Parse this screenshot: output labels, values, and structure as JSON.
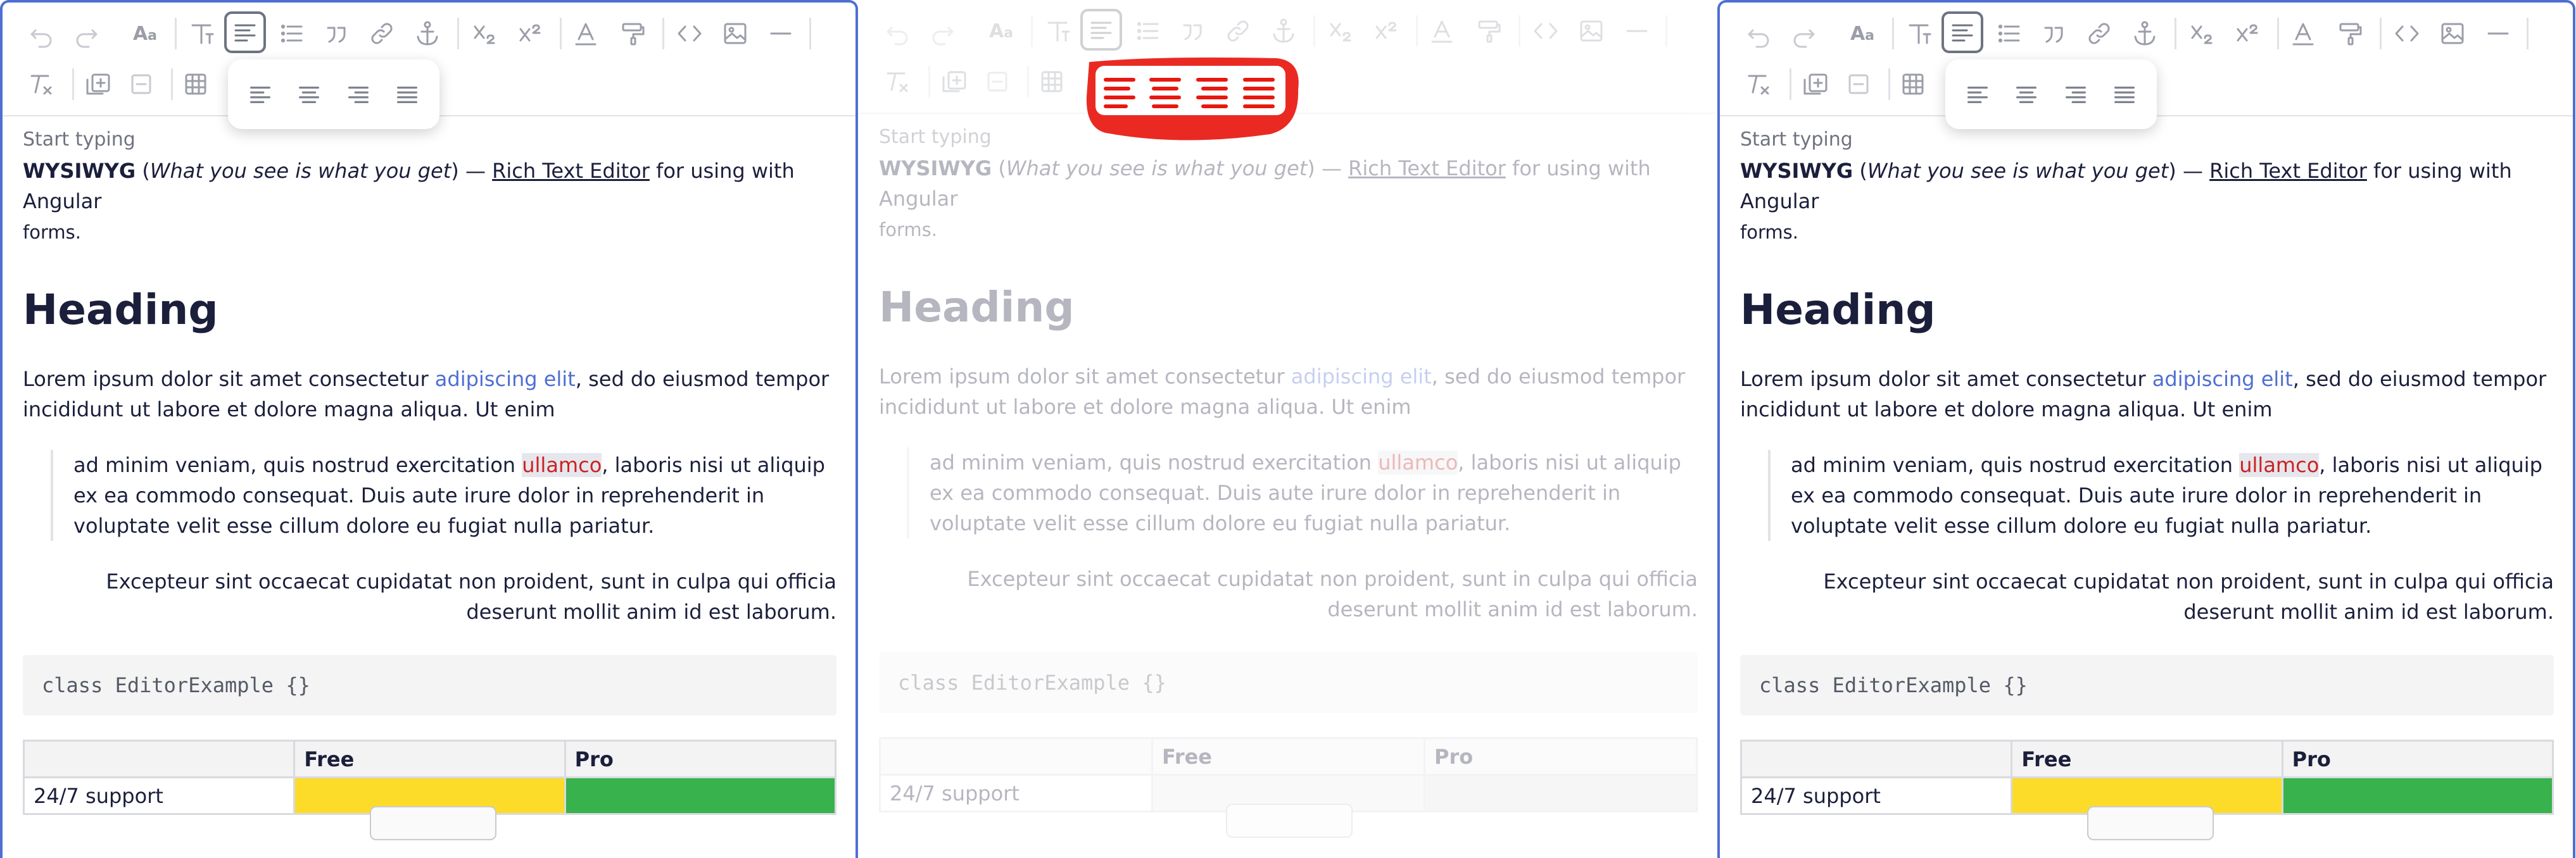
{
  "panels": [
    {
      "state": "focused",
      "placeholder": "Start typing",
      "intro": {
        "bold": "WYSIWYG",
        "open_paren": " (",
        "italic": "What you see is what you get",
        "close_dash": ") — ",
        "link": "Rich Text Editor",
        "rest": " for using with Angular",
        "tail": "forms."
      },
      "heading": "Heading",
      "para": {
        "before": "Lorem ipsum dolor sit amet consectetur ",
        "link": "adipiscing elit",
        "after": ", sed do eiusmod tempor incididunt ut labore et dolore magna aliqua. Ut enim"
      },
      "quote": {
        "before": "ad minim veniam, quis nostrud exercitation ",
        "highlight": "ullamco",
        "after": ", laboris nisi ut aliquip ex ea commodo consequat. Duis aute irure dolor in reprehenderit in voluptate velit esse cillum dolore eu fugiat nulla pariatur."
      },
      "right_para": "Excepteur sint occaecat cupidatat non proident, sunt in culpa qui officia deserunt mollit anim id est laborum.",
      "code": "class EditorExample {}",
      "table": {
        "headers": [
          "",
          "Free",
          "Pro"
        ],
        "row_label": "24/7 support"
      }
    }
  ],
  "toolbar_icons": [
    "undo-icon",
    "redo-icon",
    "font-size-icon",
    "text-style-icon",
    "align-icon",
    "bulleted-list-icon",
    "quote-icon",
    "link-icon",
    "anchor-icon",
    "subscript-icon",
    "superscript-icon",
    "text-color-icon",
    "highlight-icon",
    "code-icon",
    "image-icon",
    "horizontal-rule-icon",
    "clear-format-icon",
    "insert-row-icon",
    "remove-row-icon",
    "table-icon"
  ],
  "align_popup": [
    "align-left-icon",
    "align-center-icon",
    "align-right-icon",
    "align-justify-icon"
  ],
  "colors": {
    "accent": "#4f6ed3",
    "table_free": "#fddb29",
    "table_pro": "#37b24d",
    "highlight_text": "#cc2222",
    "stamp": "#e8180f"
  }
}
